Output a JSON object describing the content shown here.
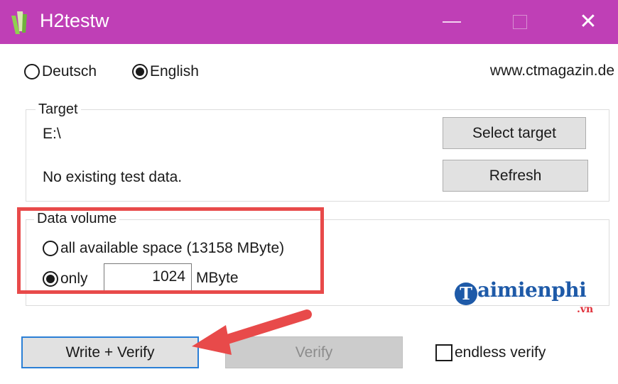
{
  "window": {
    "title": "H2testw",
    "minimize_label": "—",
    "close_label": "✕"
  },
  "language": {
    "deutsch_label": "Deutsch",
    "english_label": "English",
    "selected": "English"
  },
  "url": "www.ctmagazin.de",
  "target": {
    "group_label": "Target",
    "path": "E:\\",
    "status": "No existing test data.",
    "select_button": "Select target",
    "refresh_button": "Refresh"
  },
  "data_volume": {
    "group_label": "Data volume",
    "all_label": "all available space (13158 MByte)",
    "only_label": "only",
    "only_value": "1024",
    "unit": "MByte",
    "selected": "only"
  },
  "actions": {
    "write_verify_button": "Write + Verify",
    "verify_button": "Verify",
    "endless_verify_label": "endless verify",
    "endless_verify_checked": false
  },
  "watermark": {
    "initial": "T",
    "word": "aimienphi",
    "suffix": ".vn"
  },
  "colors": {
    "titlebar": "#bf3fb6",
    "highlight": "#e84a4a",
    "focus": "#2b7fd6"
  }
}
